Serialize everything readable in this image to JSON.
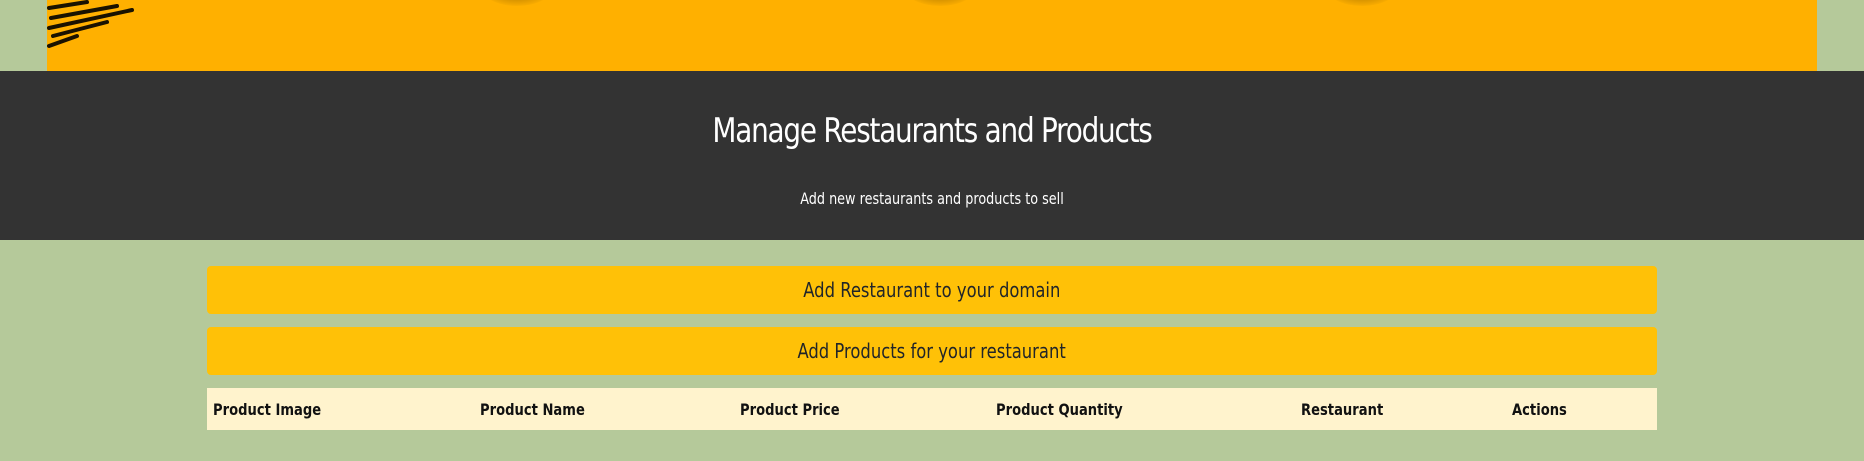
{
  "hero": {
    "title": "Manage Restaurants and Products",
    "subtitle": "Add new restaurants and products to sell"
  },
  "actions": {
    "add_restaurant_label": "Add Restaurant to your domain",
    "add_products_label": "Add Products for your restaurant"
  },
  "table": {
    "headers": [
      "Product Image",
      "Product Name",
      "Product Price",
      "Product Quantity",
      "Restaurant",
      "Actions"
    ]
  },
  "colors": {
    "banner": "#ffb000",
    "hero_bg": "#333333",
    "page_bg": "#b5c99a",
    "button_bg": "#ffc107",
    "table_head_bg": "#fff3cd"
  }
}
